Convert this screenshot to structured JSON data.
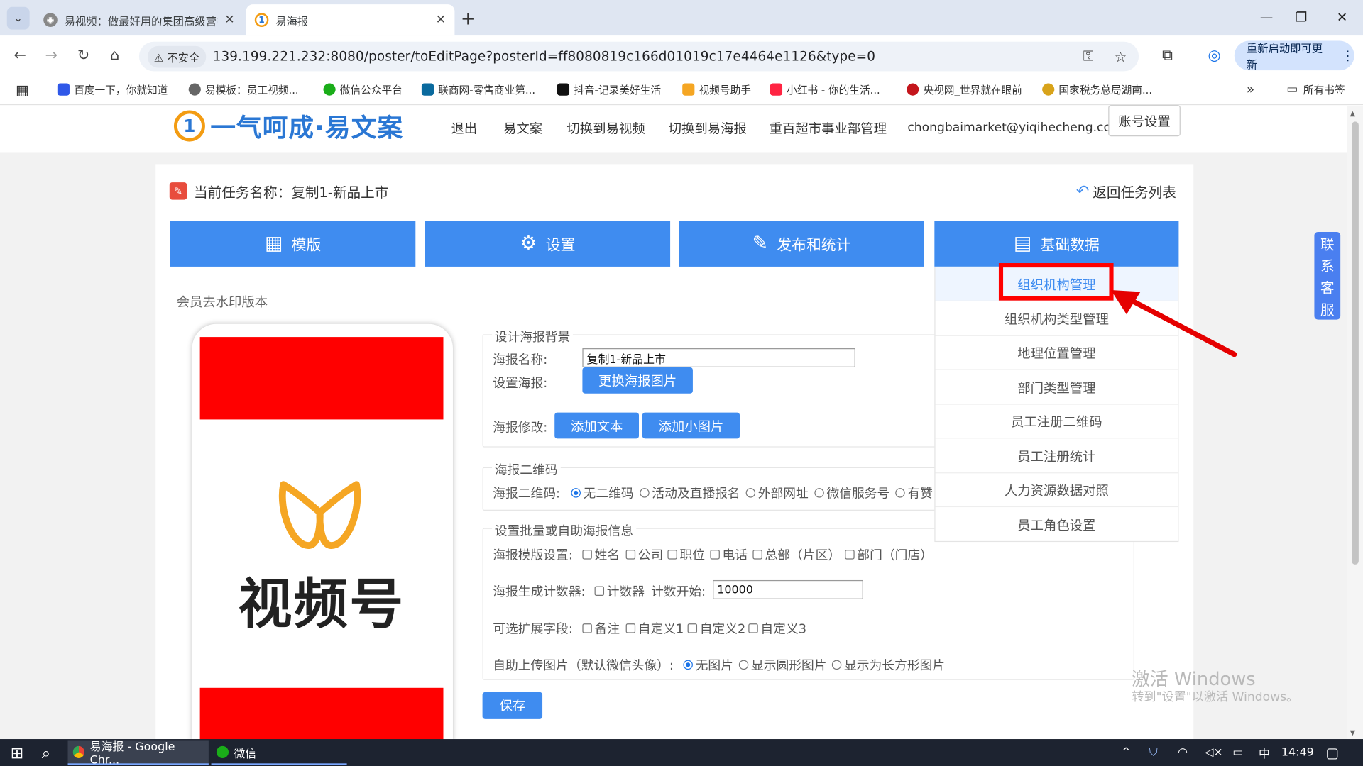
{
  "browser": {
    "tabs": [
      {
        "title": "易视频：做最好用的集团高级营销工具",
        "close": "✕"
      },
      {
        "title": "易海报",
        "close": "✕"
      }
    ],
    "new_tab": "+",
    "window_controls": {
      "minimize": "—",
      "restore": "❐",
      "close": "✕"
    },
    "insecure_label": "不安全",
    "url": "139.199.221.232:8080/poster/toEditPage?posterId=ff8080819c166d01019c17e4464e1126&type=0",
    "update_button": "重新启动即可更新",
    "bookmarks": [
      "百度一下，你就知道",
      "易模板：员工视频...",
      "微信公众平台",
      "联商网-零售商业第...",
      "抖音-记录美好生活",
      "视频号助手",
      "小红书 - 你的生活...",
      "央视网_世界就在眼前",
      "国家税务总局湖南..."
    ],
    "more_bookmarks": "»",
    "all_bookmarks": "所有书签"
  },
  "site": {
    "logo_mark": "1",
    "logo_text": "一气呵成·易文案",
    "nav": [
      "退出",
      "易文案",
      "切换到易视频",
      "切换到易海报",
      "重百超市事业部管理",
      "chongbaimarket@yiqihecheng.cc"
    ],
    "account_button": "账号设置"
  },
  "task": {
    "label": "当前任务名称：",
    "name": "复制1-新品上市",
    "back": "返回任务列表"
  },
  "main_buttons": [
    {
      "label": "模版",
      "icon": "▦"
    },
    {
      "label": "设置",
      "icon": "⚙"
    },
    {
      "label": "发布和统计",
      "icon": "✎"
    },
    {
      "label": "基础数据",
      "icon": "▤"
    }
  ],
  "dropdown": [
    "组织机构管理",
    "组织机构类型管理",
    "地理位置管理",
    "部门类型管理",
    "员工注册二维码",
    "员工注册统计",
    "人力资源数据对照",
    "员工角色设置"
  ],
  "vip_text": "会员去水印版本",
  "preview": {
    "text": "视频号"
  },
  "form": {
    "bg_legend": "设计海报背景",
    "poster_name_label": "海报名称:",
    "poster_name_value": "复制1-新品上市",
    "set_poster_label": "设置海报:",
    "change_image": "更换海报图片",
    "modify_label": "海报修改:",
    "add_text": "添加文本",
    "add_image": "添加小图片",
    "qr_legend": "海报二维码",
    "qr_label": "海报二维码:",
    "qr_options": [
      "无二维码",
      "活动及直播报名",
      "外部网址",
      "微信服务号",
      "有赞"
    ],
    "batch_legend": "设置批量或自助海报信息",
    "template_label": "海报模版设置:",
    "template_options": [
      "姓名",
      "公司",
      "职位",
      "电话",
      "总部（片区）",
      "部门（门店）"
    ],
    "counter_label": "海报生成计数器:",
    "counter_option": "计数器",
    "counter_start_label": "计数开始:",
    "counter_start_value": "10000",
    "ext_label": "可选扩展字段:",
    "ext_options": [
      "备注",
      "自定义1",
      "自定义2",
      "自定义3"
    ],
    "upload_label": "自助上传图片（默认微信头像）:",
    "upload_options": [
      "无图片",
      "显示圆形图片",
      "显示为长方形图片"
    ],
    "save": "保存"
  },
  "side_contact": [
    "联",
    "系",
    "客",
    "服"
  ],
  "watermark": {
    "line1": "激活 Windows",
    "line2": "转到\"设置\"以激活 Windows。"
  },
  "taskbar": {
    "chrome_item": "易海报 - Google Chr...",
    "wechat_item": "微信",
    "ime": "中",
    "time": "14:49"
  },
  "colors": {
    "accent": "#3f8cf0",
    "highlight": "#ff0000",
    "preview_red": "#ff0000",
    "logo_orange": "#f39c12"
  }
}
